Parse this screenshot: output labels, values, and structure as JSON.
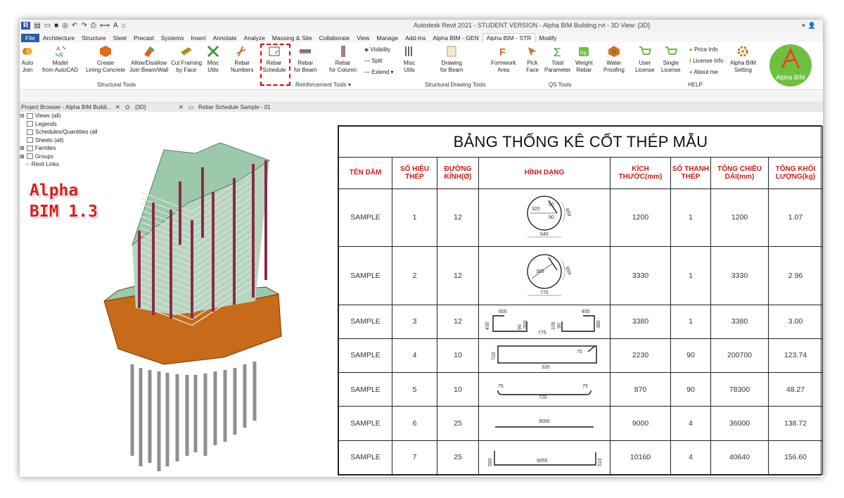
{
  "titlebar": {
    "title": "Autodesk Revit 2021 - STUDENT VERSION - Alpha BIM Building.rvt - 3D View: {3D}",
    "logo_letter": "R"
  },
  "tabs": [
    "File",
    "Architecture",
    "Structure",
    "Steel",
    "Precast",
    "Systems",
    "Insert",
    "Annotate",
    "Analyze",
    "Massing & Site",
    "Collaborate",
    "View",
    "Manage",
    "Add-Ins",
    "Alpha BIM - GEN",
    "Alpha BIM - STR",
    "Modify"
  ],
  "active_tab": "Alpha BIM - STR",
  "ribbon": {
    "buttons": [
      {
        "l1": "Auto",
        "l2": "Join"
      },
      {
        "l1": "Model",
        "l2": "from AutoCAD"
      },
      {
        "l1": "Create",
        "l2": "Lining Concrete"
      },
      {
        "l1": "Allow/Disallow",
        "l2": "Join Beam/Wall"
      },
      {
        "l1": "Cut Framing",
        "l2": "by Face"
      },
      {
        "l1": "Misc",
        "l2": "Utils"
      },
      {
        "l1": "Rebar",
        "l2": "Numbers"
      },
      {
        "l1": "Rebar",
        "l2": "Schedule"
      },
      {
        "l1": "Rebar",
        "l2": "for Beam"
      },
      {
        "l1": "Rebar",
        "l2": "for Column"
      },
      {
        "l1": "Misc",
        "l2": "Utils"
      },
      {
        "l1": "Drawing",
        "l2": "for Beam"
      },
      {
        "l1": "Formwork",
        "l2": "Area"
      },
      {
        "l1": "Pick",
        "l2": "Face"
      },
      {
        "l1": "Total",
        "l2": "Parameter"
      },
      {
        "l1": "Weight",
        "l2": "Rebar"
      },
      {
        "l1": "Water",
        "l2": "Proofing"
      },
      {
        "l1": "User",
        "l2": "License"
      },
      {
        "l1": "Single",
        "l2": "License"
      },
      {
        "l1": "Alpha BIM",
        "l2": "Setting"
      }
    ],
    "small": [
      "Visibility",
      "Split",
      "Extend",
      "Price Info",
      "License Info",
      "About me"
    ],
    "panels": [
      "Structural Tools",
      "Reinforcement Tools ▾",
      "Structural Drawing Tools",
      "QS Tools",
      "HELP"
    ],
    "logo_text": "Alpha BIM"
  },
  "view_tabs": [
    "Project Browser - Alpha BIM Buildi...",
    "{3D}",
    "Rebar Schedule Sample - 01"
  ],
  "browser": [
    "Views (all)",
    "Legends",
    "Schedules/Quantities (all",
    "Sheets (all)",
    "Families",
    "Groups",
    "Revit Links"
  ],
  "stamp": {
    "l1": "Alpha",
    "l2": "BIM 1.3"
  },
  "schedule": {
    "title": "BẢNG THỐNG KÊ CỐT THÉP MẪU",
    "headers": [
      "TÊN DẦM",
      "SỐ HIỆU THÉP",
      "ĐƯỜNG KÍNH(Ø)",
      "HÌNH DẠNG",
      "KÍCH THƯỚC(mm)",
      "SỐ THANH THÉP",
      "TỔNG CHIỀU DÀI(mm)",
      "TỔNG KHỐI LƯỢNG(kg)"
    ],
    "rows": [
      {
        "name": "SAMPLE",
        "no": "1",
        "dia": "12",
        "len": "1200",
        "qty": "1",
        "total": "1200",
        "kg": "1.07",
        "d": [
          "320",
          "90",
          "90",
          "659",
          "640"
        ]
      },
      {
        "name": "SAMPLE",
        "no": "2",
        "dia": "12",
        "len": "3330",
        "qty": "1",
        "total": "3330",
        "kg": "2.96",
        "d": [
          "385",
          "659",
          "770"
        ]
      },
      {
        "name": "SAMPLE",
        "no": "3",
        "dia": "12",
        "len": "3380",
        "qty": "1",
        "total": "3380",
        "kg": "3.00",
        "d": [
          "600",
          "405",
          "430",
          "90",
          "500",
          "775",
          "105",
          "90",
          "380"
        ]
      },
      {
        "name": "SAMPLE",
        "no": "4",
        "dia": "10",
        "len": "2230",
        "qty": "90",
        "total": "200700",
        "kg": "123.74",
        "d": [
          "720",
          "75",
          "320"
        ]
      },
      {
        "name": "SAMPLE",
        "no": "5",
        "dia": "10",
        "len": "870",
        "qty": "90",
        "total": "78300",
        "kg": "48.27",
        "d": [
          "75",
          "720",
          "75"
        ]
      },
      {
        "name": "SAMPLE",
        "no": "6",
        "dia": "25",
        "len": "9000",
        "qty": "4",
        "total": "36000",
        "kg": "138.72",
        "d": [
          "9000"
        ]
      },
      {
        "name": "SAMPLE",
        "no": "7",
        "dia": "25",
        "len": "10160",
        "qty": "4",
        "total": "40640",
        "kg": "156.60",
        "d": [
          "590",
          "9055",
          "515"
        ]
      }
    ]
  },
  "colors": {
    "file_tab": "#2a5aa8",
    "header_red": "#d41a1a",
    "stamp_red": "#d61e1e",
    "logo_green": "#6ec13f",
    "slab": "#9cc9ab",
    "column": "#8a2b4a",
    "podium": "#c76a1a"
  }
}
